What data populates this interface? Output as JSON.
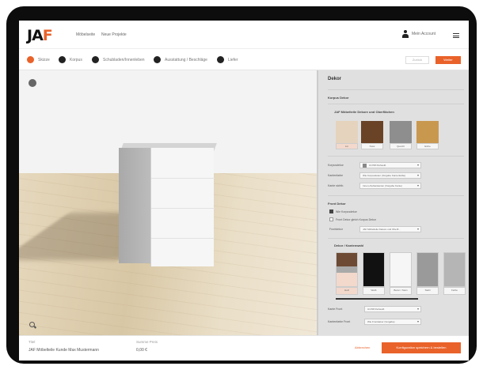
{
  "brand": {
    "logo_left": "JA",
    "logo_accent": "F",
    "accent": "#e9622a"
  },
  "nav": {
    "link1": "Möbelseite",
    "link2": "Neue Projekte"
  },
  "user": {
    "name": "Mein Account"
  },
  "steps": [
    {
      "label": "Skizze",
      "active": true
    },
    {
      "label": "Korpus",
      "active": false
    },
    {
      "label": "Schubladen/Innenleben",
      "active": false
    },
    {
      "label": "Ausstattung / Beschläge",
      "active": false
    },
    {
      "label": "Liefer",
      "active": false
    }
  ],
  "step_buttons": {
    "back": "Zurück",
    "next": "Weiter"
  },
  "panel": {
    "title": "Dekor",
    "subtitle": "Korpus Dekor",
    "korpus_group_title": "JAF Möbelteile Dekore und Oberflächen",
    "korpus_swatches": [
      {
        "label": "Lin",
        "color": "#e6d3bd"
      },
      {
        "label": "Nuss",
        "color": "#6a4327"
      },
      {
        "label": "Quarzit",
        "color": "#8e8e8e"
      },
      {
        "label": "Eiche",
        "color": "#c9984f"
      }
    ],
    "fields": [
      {
        "label": "Korpusdekor",
        "value": "U1708 Perlweiß"
      },
      {
        "label": "Kantenfarbe",
        "value": "Wie Korpusdekor (Vorgabe Kantenfarbe)"
      },
      {
        "label": "Kante sichtb.",
        "value": "Innen-/Außenkanten (Vorgabe Kante)"
      }
    ],
    "front_title": "Front Dekor",
    "front_checks": [
      {
        "label": "Wie Korpusdekor",
        "checked": true
      },
      {
        "label": "Front Dekor gleich Korpus Dekor",
        "checked": false
      }
    ],
    "front_field": {
      "label": "Frontdekor",
      "value": "JAF Möbelteile Dekore und Oberfl..."
    },
    "front_group_title": "Dekor / Kantenwahl",
    "front_swatches": [
      {
        "label": "Holz",
        "color": "#6d4a33"
      },
      {
        "label": "Weiß",
        "color": "#111111"
      },
      {
        "label": "Beton / Stein",
        "color": "#f6f6f6"
      },
      {
        "label": "Stahl",
        "color": "#9a9a9a"
      },
      {
        "label": "Farbe",
        "color": "#b5b5b5"
      }
    ],
    "bottom_fields": [
      {
        "label": "Kante Front",
        "value": "U1708 Perlweiß"
      },
      {
        "label": "Kantenfarbe Front",
        "value": "Wie Frontdekor (Vorgabe)"
      }
    ]
  },
  "footer": {
    "title_label": "Titel",
    "title_value": "JAF Möbelteile Kunde Max Mustermann",
    "sum_label": "Summe Preis",
    "sum_value": "0,00 €",
    "cancel": "Abbrechen",
    "save": "Konfiguration speichern & bestellen"
  }
}
